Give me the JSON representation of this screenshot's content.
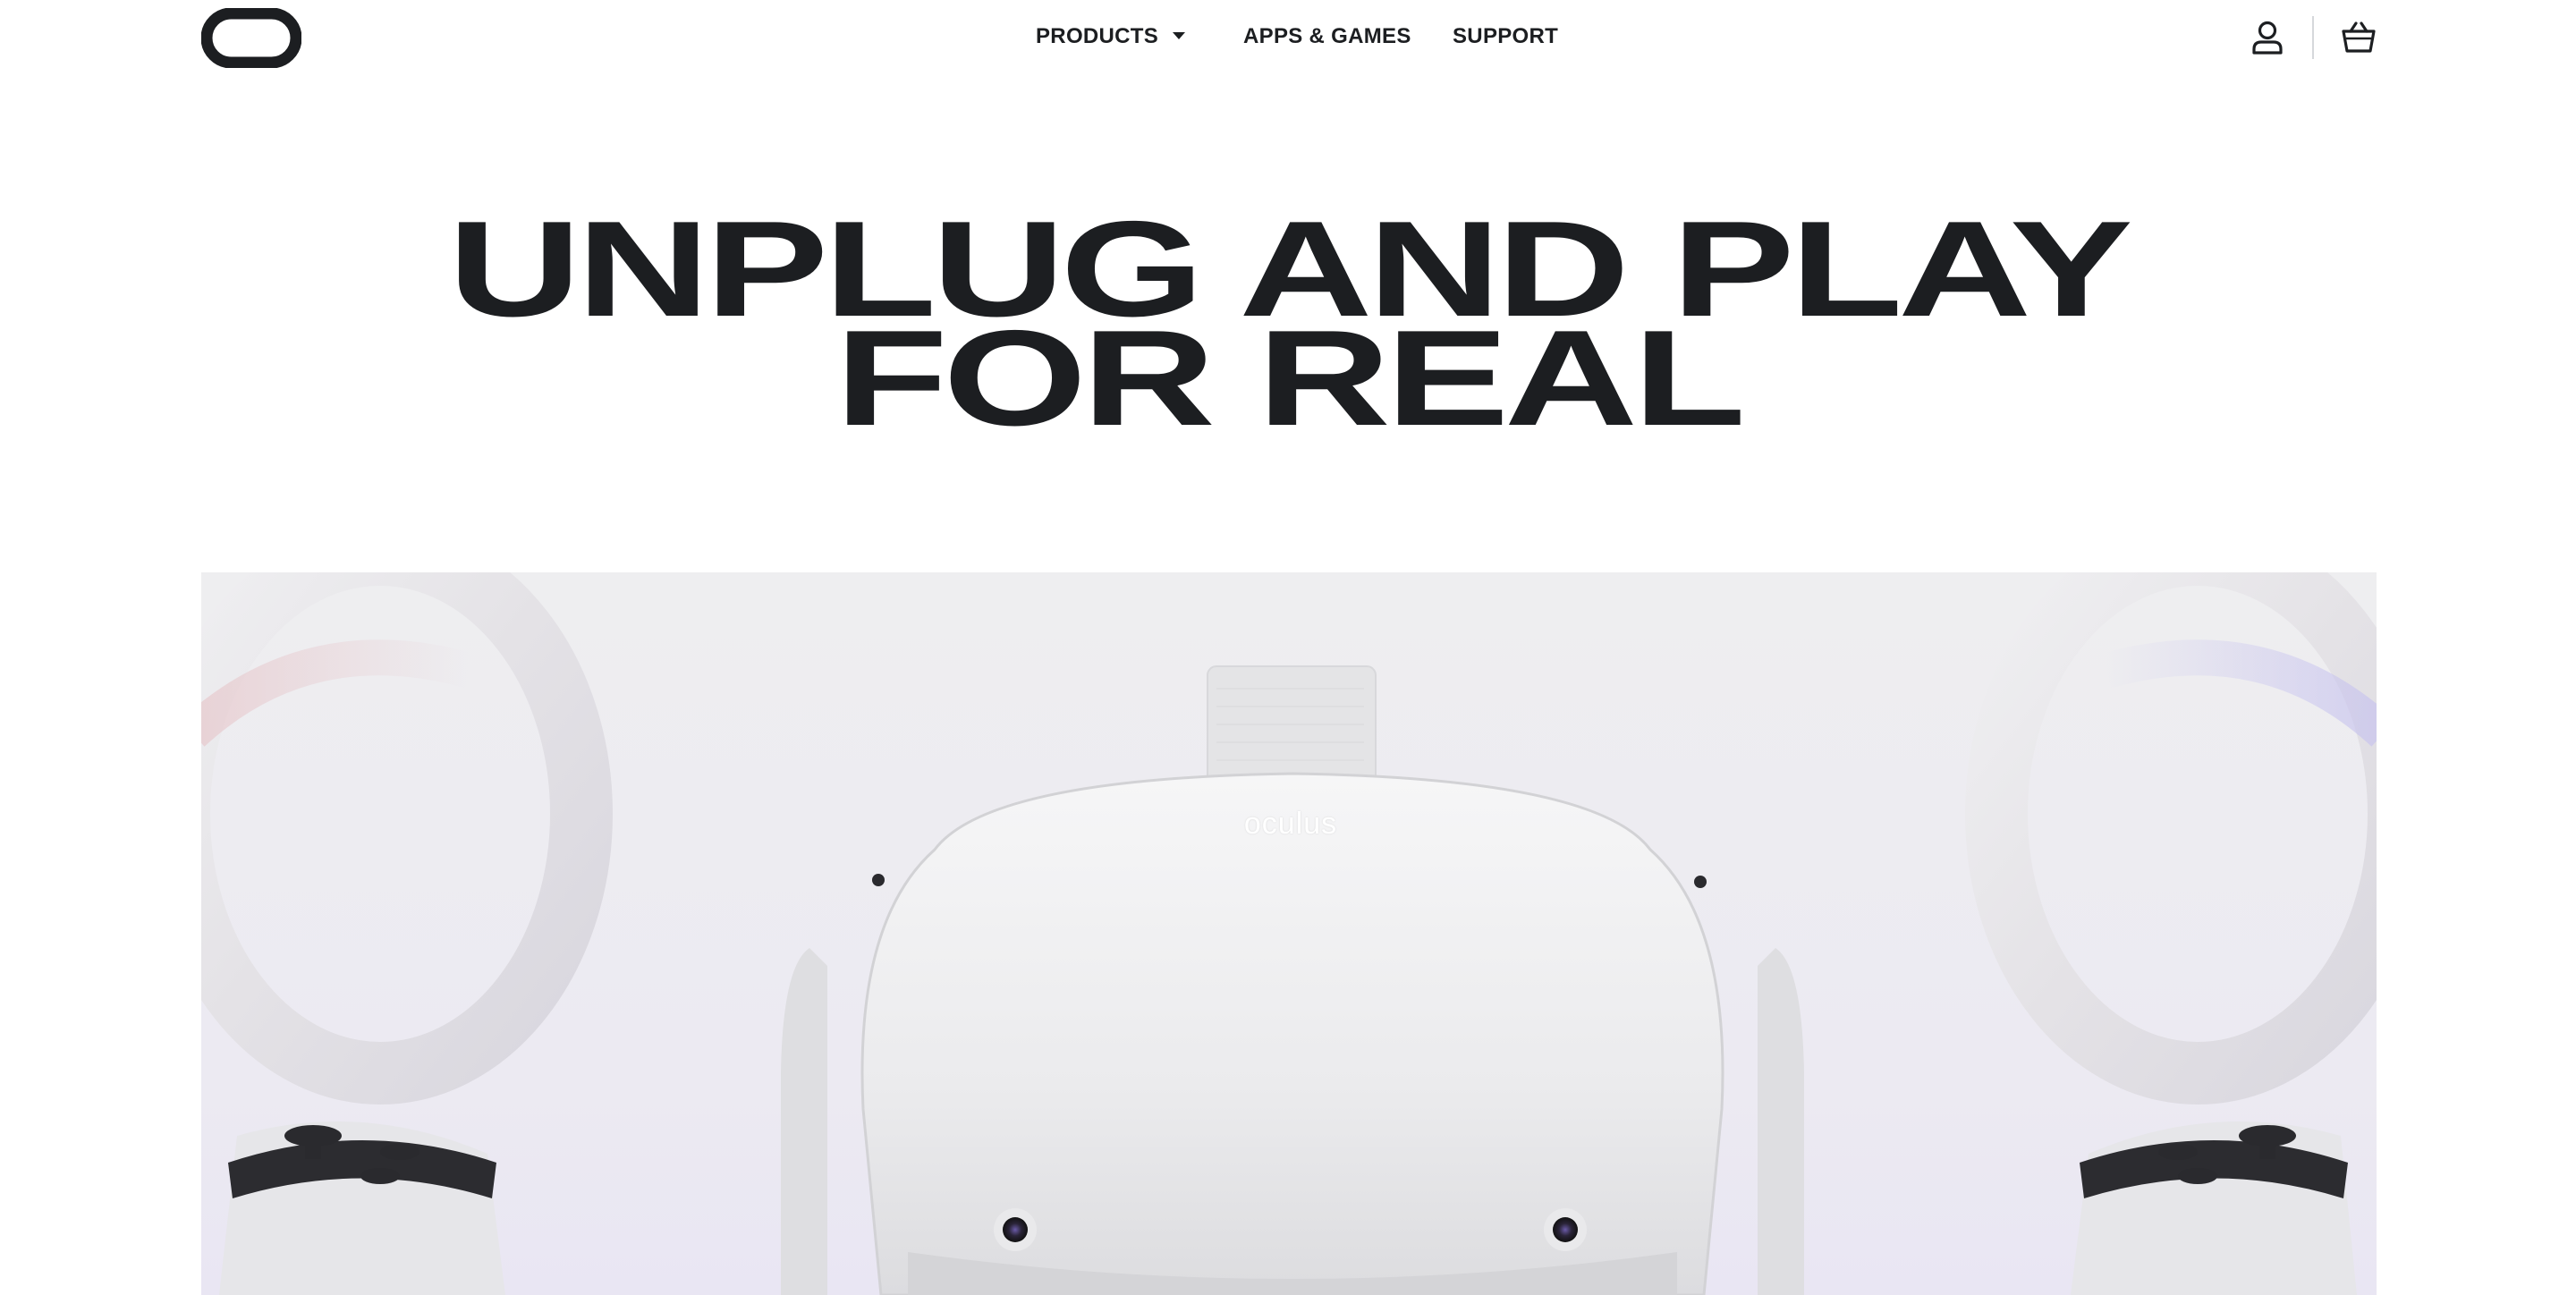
{
  "header": {
    "logo_icon": "oculus-logo-icon",
    "nav": {
      "products": "PRODUCTS",
      "apps_games": "APPS & GAMES",
      "support": "SUPPORT"
    },
    "account_icon": "account-icon",
    "cart_icon": "cart-icon"
  },
  "hero": {
    "title_line1": "UNPLUG AND PLAY",
    "title_line2": "FOR REAL"
  },
  "product_image": {
    "brand_label": "oculus"
  },
  "colors": {
    "text": "#1c1e21",
    "image_bg": "#eeeef0"
  }
}
